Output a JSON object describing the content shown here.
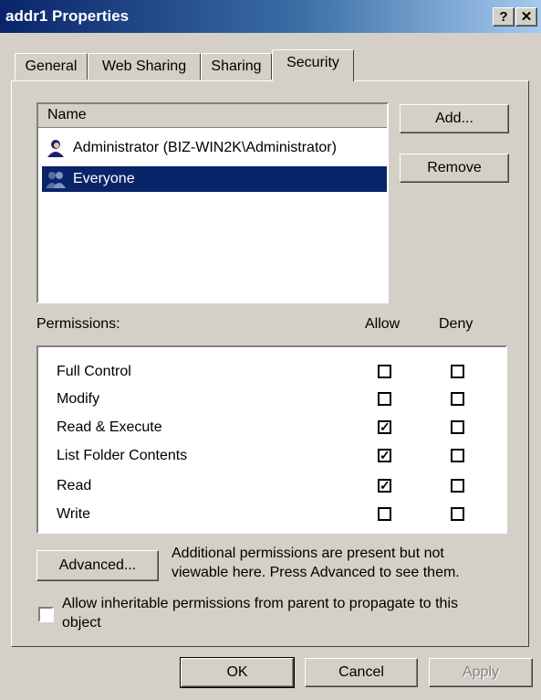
{
  "window": {
    "title": "addr1 Properties",
    "help_label": "?",
    "close_label": "✕"
  },
  "tabs": [
    {
      "label": "General"
    },
    {
      "label": "Web Sharing"
    },
    {
      "label": "Sharing"
    },
    {
      "label": "Security"
    }
  ],
  "names": {
    "header": "Name",
    "users": [
      {
        "label": "Administrator (BIZ-WIN2K\\Administrator)",
        "icon": "user-icon"
      },
      {
        "label": "Everyone",
        "icon": "group-icon"
      }
    ],
    "add_label": "Add...",
    "remove_label": "Remove"
  },
  "permissions": {
    "label": "Permissions:",
    "allow_header": "Allow",
    "deny_header": "Deny",
    "rows": [
      {
        "label": "Full Control",
        "allow": "",
        "deny": ""
      },
      {
        "label": "Modify",
        "allow": "",
        "deny": ""
      },
      {
        "label": "Read & Execute",
        "allow": "✓",
        "deny": ""
      },
      {
        "label": "List Folder Contents",
        "allow": "✓",
        "deny": ""
      },
      {
        "label": "Read",
        "allow": "✓",
        "deny": ""
      },
      {
        "label": "Write",
        "allow": "",
        "deny": ""
      }
    ]
  },
  "advanced": {
    "button_label": "Advanced...",
    "note_line1": "Additional permissions are present but not",
    "note_line2": "viewable here. Press Advanced to see them."
  },
  "inherit": {
    "line1": "Allow inheritable permissions from parent to propagate to this",
    "line2": "object"
  },
  "footer": {
    "ok_label": "OK",
    "cancel_label": "Cancel",
    "apply_label": "Apply"
  }
}
